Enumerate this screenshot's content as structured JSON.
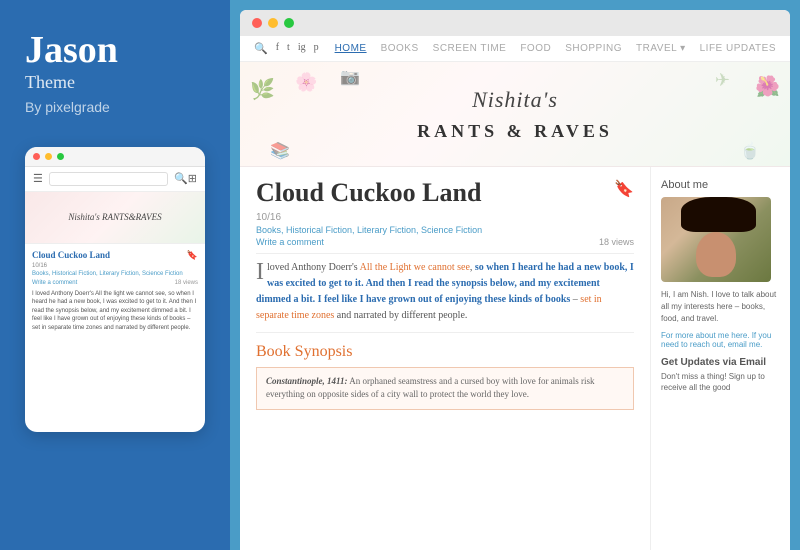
{
  "leftPanel": {
    "themeName": "Jason",
    "themeLabel": "Theme",
    "byLine": "By pixelgrade"
  },
  "browserWindow": {
    "dots": [
      "red",
      "yellow",
      "green"
    ]
  },
  "blogNav": {
    "icons": [
      "search",
      "facebook",
      "twitter",
      "instagram",
      "pinterest"
    ],
    "menuItems": [
      {
        "label": "HOME",
        "active": true
      },
      {
        "label": "BOOKS",
        "active": false
      },
      {
        "label": "SCREEN TIME",
        "active": false
      },
      {
        "label": "FOOD",
        "active": false
      },
      {
        "label": "SHOPPING",
        "active": false
      },
      {
        "label": "TRAVEL ▾",
        "active": false
      },
      {
        "label": "LIFE UPDATES",
        "active": false
      }
    ]
  },
  "blogBanner": {
    "italicPart": "Nishita's",
    "boldPart": "RANTS & RAVES",
    "decorations": [
      "🌿",
      "🌸",
      "✈",
      "📷",
      "🌺"
    ]
  },
  "post": {
    "title": "Cloud Cuckoo Land",
    "date": "10/16",
    "tags": "Books, Historical Fiction, Literary Fiction, Science Fiction",
    "writeComment": "Write a comment",
    "views": "18 views",
    "bodyText": "loved Anthony Doerr's All the Light we cannot see, so when I heard he had a new book, I was excited to get to it. And then I read the synopsis below, and my excitement dimmed a bit. I feel like I have grown out of enjoying these kinds of books – set in separate time zones and narrated by different people.",
    "dropCap": "I",
    "sectionTitle": "Book Synopsis",
    "synopsisPlaceName": "Constantinople, 1411:",
    "synopsisText": "An orphaned seamstress and a cursed boy with love for animals risk everything on opposite sides of a city wall to protect the world they love."
  },
  "sidebar": {
    "aboutTitle": "About me",
    "bioText": "Hi, I am Nish. I love to talk about all my interests here – books, food, and travel.",
    "contactText": "For more about me here. If you need to reach out, email me.",
    "updatesTitle": "Get Updates via Email",
    "updatesText": "Don't miss a thing! Sign up to receive all the good"
  },
  "mobilePreview": {
    "blogHeaderText": "Nishita's RANTS&RAVES",
    "postTitle": "Cloud Cuckoo Land",
    "postDate": "10/16",
    "postTags": "Books, Historical Fiction, Literary Fiction, Science Fiction",
    "writeComment": "Write a comment",
    "postViews": "18 views",
    "postExcerpt": "I loved Anthony Doerr's All the light we cannot see, so when I heard he had a new book, I was excited to get to it. And then I read the synopsis below, and my excitement dimmed a bit. I feel like I have grown out of enjoying these kinds of books – set in separate time zones and narrated by different people."
  }
}
